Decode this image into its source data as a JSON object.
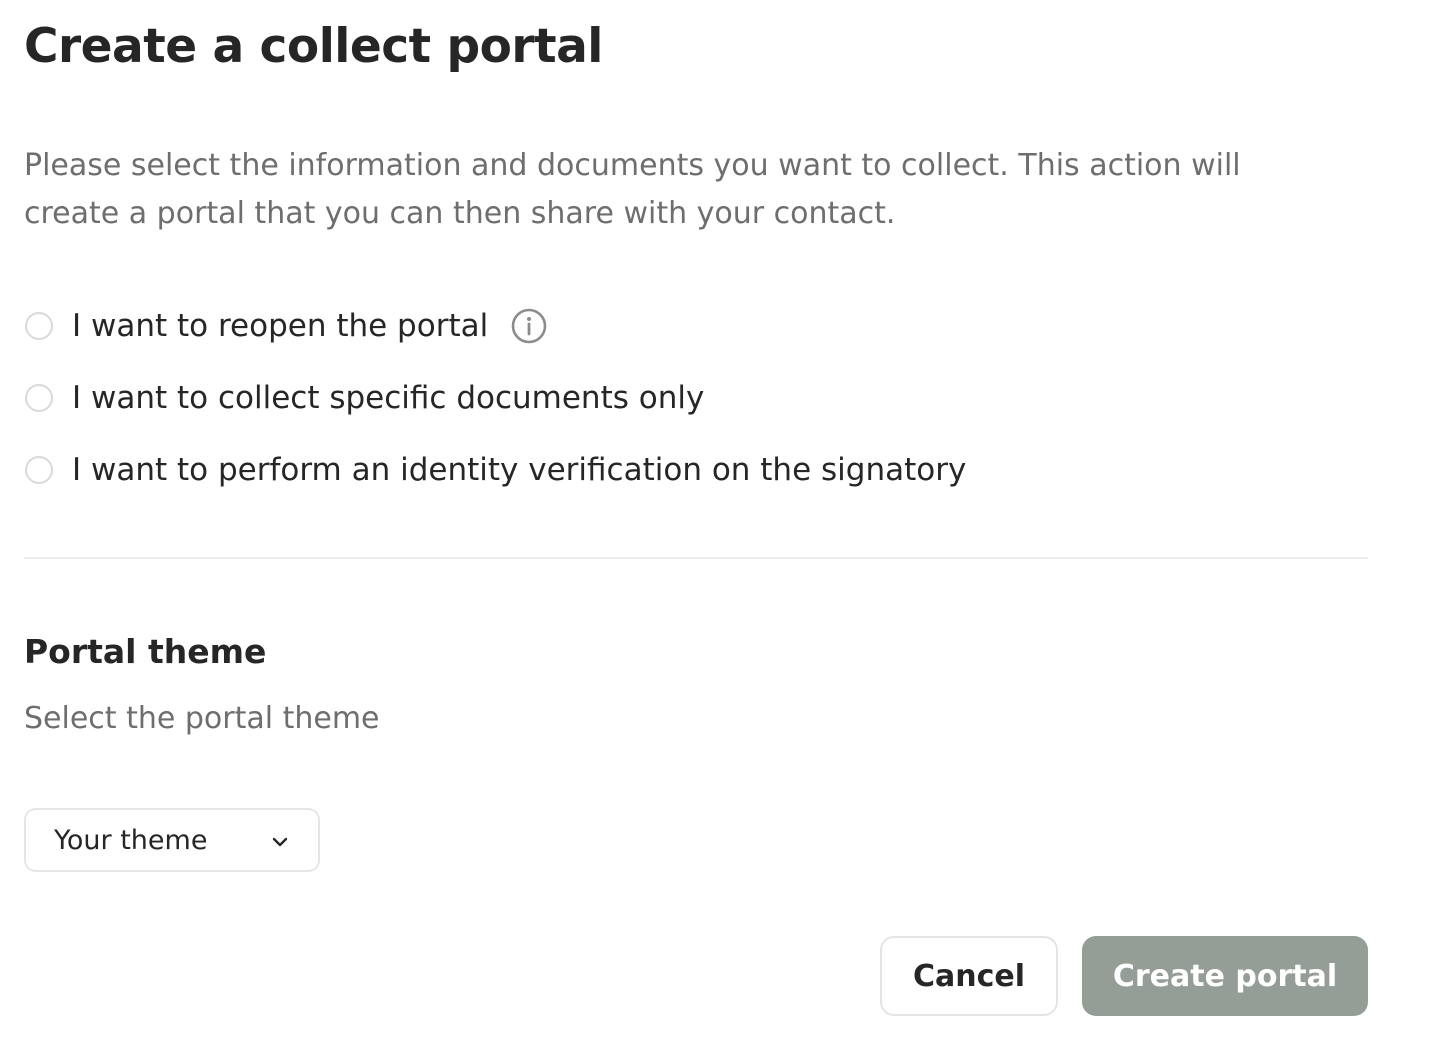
{
  "dialog": {
    "title": "Create a collect portal",
    "description": "Please select the information and documents you want to collect. This action will create a portal that you can then share with your contact.",
    "options": [
      {
        "label": "I want to reopen the portal",
        "selected": false,
        "has_info_icon": true,
        "icon": "info-icon"
      },
      {
        "label": "I want to collect specific documents only",
        "selected": false
      },
      {
        "label": "I want to perform an identity verification on the signatory",
        "selected": false
      }
    ],
    "theme_section": {
      "title": "Portal theme",
      "subtitle": "Select the portal theme",
      "select_value": "Your theme",
      "select_icon": "chevron-down-icon"
    },
    "actions": {
      "cancel_label": "Cancel",
      "create_label": "Create portal",
      "create_enabled": false
    }
  },
  "colors": {
    "text_primary": "#262626",
    "text_secondary": "#6e6e6e",
    "primary_button_disabled": "#949e97",
    "border": "#e4e4e4"
  }
}
